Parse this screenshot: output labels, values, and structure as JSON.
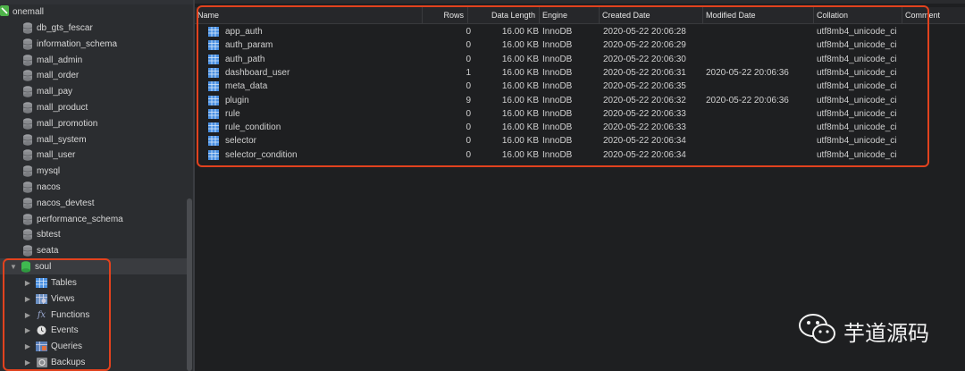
{
  "sidebar": {
    "connection": "onemall",
    "databases": [
      "db_gts_fescar",
      "information_schema",
      "mall_admin",
      "mall_order",
      "mall_pay",
      "mall_product",
      "mall_promotion",
      "mall_system",
      "mall_user",
      "mysql",
      "nacos",
      "nacos_devtest",
      "performance_schema",
      "sbtest",
      "seata"
    ],
    "selected_db": "soul",
    "children": [
      {
        "label": "Tables",
        "icon": "table-icon"
      },
      {
        "label": "Views",
        "icon": "view-icon"
      },
      {
        "label": "Functions",
        "icon": "function-icon",
        "glyph": "fx"
      },
      {
        "label": "Events",
        "icon": "clock-icon"
      },
      {
        "label": "Queries",
        "icon": "query-icon"
      },
      {
        "label": "Backups",
        "icon": "backup-icon"
      }
    ]
  },
  "table": {
    "headers": {
      "name": "Name",
      "rows": "Rows",
      "data_length": "Data Length",
      "engine": "Engine",
      "created": "Created Date",
      "modified": "Modified Date",
      "collation": "Collation",
      "comment": "Comment"
    },
    "rows": [
      {
        "name": "app_auth",
        "rows": "0",
        "data_length": "16.00 KB",
        "engine": "InnoDB",
        "created": "2020-05-22 20:06:28",
        "modified": "",
        "collation": "utf8mb4_unicode_ci",
        "comment": ""
      },
      {
        "name": "auth_param",
        "rows": "0",
        "data_length": "16.00 KB",
        "engine": "InnoDB",
        "created": "2020-05-22 20:06:29",
        "modified": "",
        "collation": "utf8mb4_unicode_ci",
        "comment": ""
      },
      {
        "name": "auth_path",
        "rows": "0",
        "data_length": "16.00 KB",
        "engine": "InnoDB",
        "created": "2020-05-22 20:06:30",
        "modified": "",
        "collation": "utf8mb4_unicode_ci",
        "comment": ""
      },
      {
        "name": "dashboard_user",
        "rows": "1",
        "data_length": "16.00 KB",
        "engine": "InnoDB",
        "created": "2020-05-22 20:06:31",
        "modified": "2020-05-22 20:06:36",
        "collation": "utf8mb4_unicode_ci",
        "comment": ""
      },
      {
        "name": "meta_data",
        "rows": "0",
        "data_length": "16.00 KB",
        "engine": "InnoDB",
        "created": "2020-05-22 20:06:35",
        "modified": "",
        "collation": "utf8mb4_unicode_ci",
        "comment": ""
      },
      {
        "name": "plugin",
        "rows": "9",
        "data_length": "16.00 KB",
        "engine": "InnoDB",
        "created": "2020-05-22 20:06:32",
        "modified": "2020-05-22 20:06:36",
        "collation": "utf8mb4_unicode_ci",
        "comment": ""
      },
      {
        "name": "rule",
        "rows": "0",
        "data_length": "16.00 KB",
        "engine": "InnoDB",
        "created": "2020-05-22 20:06:33",
        "modified": "",
        "collation": "utf8mb4_unicode_ci",
        "comment": ""
      },
      {
        "name": "rule_condition",
        "rows": "0",
        "data_length": "16.00 KB",
        "engine": "InnoDB",
        "created": "2020-05-22 20:06:33",
        "modified": "",
        "collation": "utf8mb4_unicode_ci",
        "comment": ""
      },
      {
        "name": "selector",
        "rows": "0",
        "data_length": "16.00 KB",
        "engine": "InnoDB",
        "created": "2020-05-22 20:06:34",
        "modified": "",
        "collation": "utf8mb4_unicode_ci",
        "comment": ""
      },
      {
        "name": "selector_condition",
        "rows": "0",
        "data_length": "16.00 KB",
        "engine": "InnoDB",
        "created": "2020-05-22 20:06:34",
        "modified": "",
        "collation": "utf8mb4_unicode_ci",
        "comment": ""
      }
    ]
  },
  "watermark": {
    "text": "芋道源码",
    "icon": "wechat-icon"
  },
  "colors": {
    "highlight": "#e2421e",
    "db_green": "#3fb950",
    "table_blue": "#4a90e2"
  }
}
